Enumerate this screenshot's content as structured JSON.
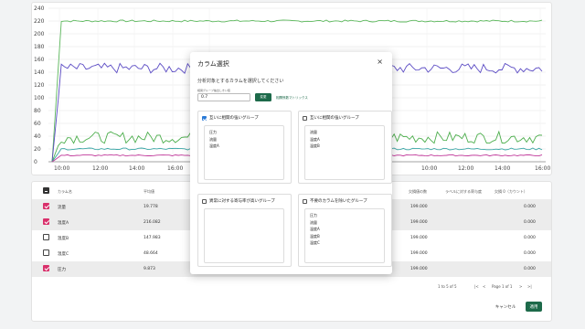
{
  "chart_data": {
    "type": "line",
    "x_ticks": [
      "10:00",
      "12:00",
      "14:00",
      "16:00",
      "18:00",
      "10:00",
      "12:00",
      "14:00",
      "16:00"
    ],
    "y_ticks": [
      "0",
      "20",
      "40",
      "60",
      "80",
      "100",
      "120",
      "140",
      "160",
      "180",
      "200",
      "220",
      "240"
    ],
    "ylim": [
      0,
      240
    ],
    "grid": true,
    "series": [
      {
        "color": "#5cb85c",
        "level": 220,
        "amp": 1.5
      },
      {
        "color": "#5b4bc4",
        "level": 146,
        "amp": 8
      },
      {
        "color": "#4cae4c",
        "level": 38,
        "amp": 9
      },
      {
        "color": "#3aa6a6",
        "level": 20,
        "amp": 1.5
      },
      {
        "color": "#c0399a",
        "level": 10,
        "amp": 1
      }
    ]
  },
  "table": {
    "headers": [
      "カラム名",
      "平均値",
      "",
      "",
      "",
      "",
      "",
      "",
      "",
      "欠損値の数",
      "ラベルに対する寄与度",
      "欠損 0（カウント）"
    ],
    "rows": [
      {
        "name": "流量",
        "avg": "19.778",
        "count": "199.000",
        "zero": "0.000",
        "selected": true
      },
      {
        "name": "温度A",
        "avg": "216.082",
        "count": "199.000",
        "zero": "0.000",
        "selected": true
      },
      {
        "name": "温度B",
        "avg": "147.983",
        "count": "199.000",
        "zero": "0.000",
        "selected": false
      },
      {
        "name": "温度C",
        "avg": "48.664",
        "count": "199.000",
        "zero": "0.000",
        "selected": false
      },
      {
        "name": "圧力",
        "avg": "9.873",
        "count": "199.000",
        "zero": "0.000",
        "selected": true
      }
    ],
    "pagination": "1 to 5 of 5",
    "page_label": "Page 1 of 1",
    "nav_first": "|<",
    "nav_prev": "<",
    "nav_next": ">",
    "nav_last": ">|",
    "cancel_label": "キャンセル",
    "apply_label": "適用",
    "accent_color": "#d9306b",
    "primary_color": "#1d6a4a"
  },
  "modal": {
    "title": "カラム選択",
    "close": "×",
    "subtitle": "分析対象とするカラムを選択してください",
    "threshold_label": "相関グループ抽出しきい値",
    "threshold_value": "0.7",
    "change_label": "変更",
    "matrix_link": "相関係数マトリックス",
    "groups": [
      {
        "title": "互いに相関の強いグループ",
        "checked": true,
        "items": [
          "圧力",
          "流量",
          "温度A"
        ]
      },
      {
        "title": "互いに相関の強いグループ",
        "checked": false,
        "items": [
          "流量",
          "温度A",
          "温度B"
        ]
      },
      {
        "title": "異常に対する寄与率が高いグループ",
        "checked": false,
        "items": []
      },
      {
        "title": "不要のカラムを除いたグループ",
        "checked": false,
        "items": [
          "圧力",
          "流量",
          "温度A",
          "温度B",
          "温度C"
        ]
      }
    ]
  }
}
